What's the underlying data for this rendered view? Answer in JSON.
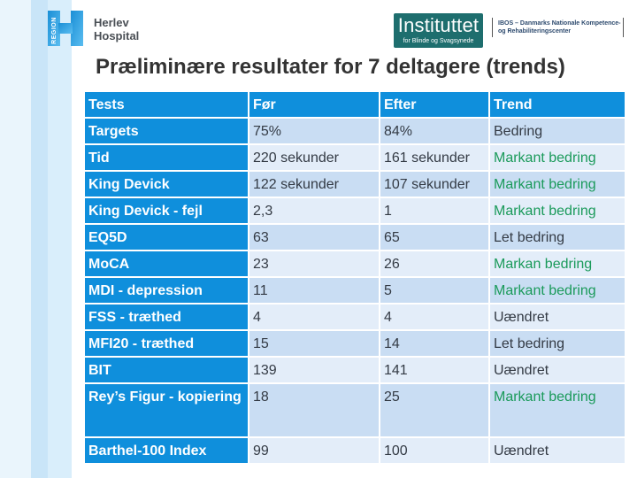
{
  "header": {
    "region_logo_text": "REGION",
    "hospital_name_line1": "Herlev",
    "hospital_name_line2": "Hospital",
    "institute_title": "Instituttet",
    "institute_subtitle": "for Blinde og Svagsynede",
    "ibos_line1": "IBOS – Danmarks Nationale Kompetence-",
    "ibos_line2": "og Rehabiliteringscenter"
  },
  "page_title": "Præliminære resultater for 7 deltagere (trends)",
  "colors": {
    "header_blue": "#0f8fdc",
    "row_dark": "#c9ddf3",
    "row_light": "#e3edf9",
    "improvement_green": "#1a9a5a",
    "institute_teal": "#1e6e6e"
  },
  "table": {
    "columns": [
      "Tests",
      "Før",
      "Efter",
      "Trend"
    ],
    "rows": [
      {
        "test": "Targets",
        "before": "75%",
        "after": "84%",
        "trend": "Bedring",
        "trend_highlight": false
      },
      {
        "test": "Tid",
        "before": "220 sekunder",
        "after": "161 sekunder",
        "trend": "Markant bedring",
        "trend_highlight": true
      },
      {
        "test": "King Devick",
        "before": "122 sekunder",
        "after": "107 sekunder",
        "trend": "Markant bedring",
        "trend_highlight": true
      },
      {
        "test": "King Devick - fejl",
        "before": "2,3",
        "after": "1",
        "trend": "Markant bedring",
        "trend_highlight": true
      },
      {
        "test": "EQ5D",
        "before": "63",
        "after": "65",
        "trend": "Let bedring",
        "trend_highlight": false
      },
      {
        "test": "MoCA",
        "before": "23",
        "after": "26",
        "trend": "Markan bedring",
        "trend_highlight": true
      },
      {
        "test": "MDI - depression",
        "before": "11",
        "after": "5",
        "trend": "Markant bedring",
        "trend_highlight": true
      },
      {
        "test": "FSS - træthed",
        "before": "4",
        "after": "4",
        "trend": "Uændret",
        "trend_highlight": false
      },
      {
        "test": "MFI20 - træthed",
        "before": "15",
        "after": "14",
        "trend": "Let bedring",
        "trend_highlight": false
      },
      {
        "test": "BIT",
        "before": "139",
        "after": "141",
        "trend": "Uændret",
        "trend_highlight": false
      },
      {
        "test": "Rey’s Figur - kopiering",
        "before": "18",
        "after": "25",
        "trend": "Markant bedring",
        "trend_highlight": true
      },
      {
        "test": "Barthel-100 Index",
        "before": "99",
        "after": "100",
        "trend": "Uændret",
        "trend_highlight": false
      }
    ]
  }
}
